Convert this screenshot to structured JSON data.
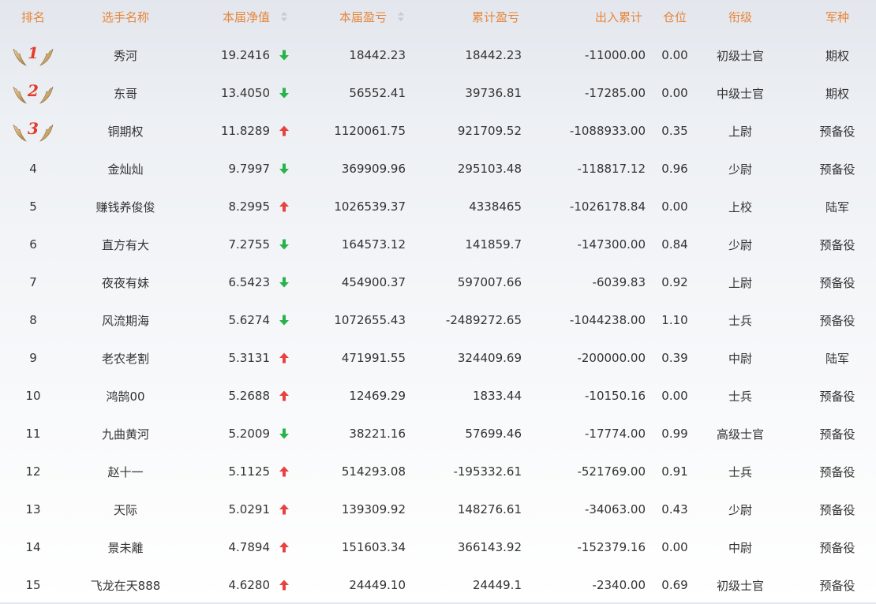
{
  "headers": {
    "rank": "排名",
    "name": "选手名称",
    "nav": "本届净值",
    "cur_pl": "本届盈亏",
    "total_pl": "累计盈亏",
    "flow": "出入累计",
    "position": "仓位",
    "title": "衔级",
    "arm": "军种"
  },
  "colors": {
    "header_text": "#e6853a",
    "up": "#e84141",
    "down": "#27b34a",
    "medal_number": "#e33a2c"
  },
  "rows": [
    {
      "rank": "1",
      "name": "秀河",
      "nav": "19.2416",
      "dir": "down",
      "cur": "18442.23",
      "total": "18442.23",
      "flow": "-11000.00",
      "pos": "0.00",
      "title": "初级士官",
      "arm": "期权"
    },
    {
      "rank": "2",
      "name": "东哥",
      "nav": "13.4050",
      "dir": "down",
      "cur": "56552.41",
      "total": "39736.81",
      "flow": "-17285.00",
      "pos": "0.00",
      "title": "中级士官",
      "arm": "期权"
    },
    {
      "rank": "3",
      "name": "铜期权",
      "nav": "11.8289",
      "dir": "up",
      "cur": "1120061.75",
      "total": "921709.52",
      "flow": "-1088933.00",
      "pos": "0.35",
      "title": "上尉",
      "arm": "预备役"
    },
    {
      "rank": "4",
      "name": "金灿灿",
      "nav": "9.7997",
      "dir": "down",
      "cur": "369909.96",
      "total": "295103.48",
      "flow": "-118817.12",
      "pos": "0.96",
      "title": "少尉",
      "arm": "预备役"
    },
    {
      "rank": "5",
      "name": "赚钱养俊俊",
      "nav": "8.2995",
      "dir": "up",
      "cur": "1026539.37",
      "total": "4338465",
      "flow": "-1026178.84",
      "pos": "0.00",
      "title": "上校",
      "arm": "陆军"
    },
    {
      "rank": "6",
      "name": "直方有大",
      "nav": "7.2755",
      "dir": "down",
      "cur": "164573.12",
      "total": "141859.7",
      "flow": "-147300.00",
      "pos": "0.84",
      "title": "少尉",
      "arm": "预备役"
    },
    {
      "rank": "7",
      "name": "夜夜有妹",
      "nav": "6.5423",
      "dir": "down",
      "cur": "454900.37",
      "total": "597007.66",
      "flow": "-6039.83",
      "pos": "0.92",
      "title": "上尉",
      "arm": "预备役"
    },
    {
      "rank": "8",
      "name": "风流期海",
      "nav": "5.6274",
      "dir": "down",
      "cur": "1072655.43",
      "total": "-2489272.65",
      "flow": "-1044238.00",
      "pos": "1.10",
      "title": "士兵",
      "arm": "预备役"
    },
    {
      "rank": "9",
      "name": "老农老割",
      "nav": "5.3131",
      "dir": "up",
      "cur": "471991.55",
      "total": "324409.69",
      "flow": "-200000.00",
      "pos": "0.39",
      "title": "中尉",
      "arm": "陆军"
    },
    {
      "rank": "10",
      "name": "鸿鹄00",
      "nav": "5.2688",
      "dir": "up",
      "cur": "12469.29",
      "total": "1833.44",
      "flow": "-10150.16",
      "pos": "0.00",
      "title": "士兵",
      "arm": "预备役"
    },
    {
      "rank": "11",
      "name": "九曲黄河",
      "nav": "5.2009",
      "dir": "down",
      "cur": "38221.16",
      "total": "57699.46",
      "flow": "-17774.00",
      "pos": "0.99",
      "title": "高级士官",
      "arm": "预备役"
    },
    {
      "rank": "12",
      "name": "赵十一",
      "nav": "5.1125",
      "dir": "up",
      "cur": "514293.08",
      "total": "-195332.61",
      "flow": "-521769.00",
      "pos": "0.91",
      "title": "士兵",
      "arm": "预备役"
    },
    {
      "rank": "13",
      "name": "天际",
      "nav": "5.0291",
      "dir": "up",
      "cur": "139309.92",
      "total": "148276.61",
      "flow": "-34063.00",
      "pos": "0.43",
      "title": "少尉",
      "arm": "预备役"
    },
    {
      "rank": "14",
      "name": "景未離",
      "nav": "4.7894",
      "dir": "up",
      "cur": "151603.34",
      "total": "366143.92",
      "flow": "-152379.16",
      "pos": "0.00",
      "title": "中尉",
      "arm": "预备役"
    },
    {
      "rank": "15",
      "name": "飞龙在天888",
      "nav": "4.6280",
      "dir": "up",
      "cur": "24449.10",
      "total": "24449.1",
      "flow": "-2340.00",
      "pos": "0.69",
      "title": "初级士官",
      "arm": "预备役"
    }
  ]
}
